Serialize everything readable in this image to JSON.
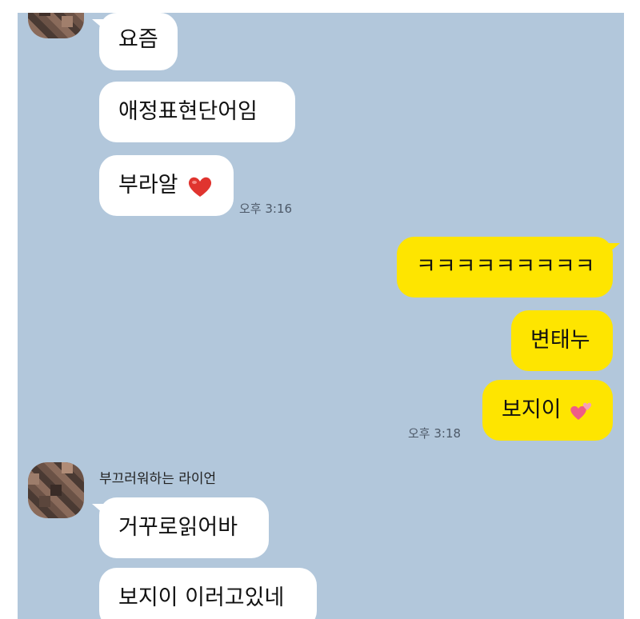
{
  "messages_top": [
    {
      "text": "요즘"
    },
    {
      "text": "애정표현단어임"
    },
    {
      "text": "부라알",
      "emoji": "heart"
    }
  ],
  "time_1": "오후 3:16",
  "messages_me": [
    {
      "text": "ㅋㅋㅋㅋㅋㅋㅋㅋㅋ"
    },
    {
      "text": "변태누"
    },
    {
      "text": "보지이",
      "emoji": "two-hearts"
    }
  ],
  "time_2": "오후 3:18",
  "sender_name": "부끄러워하는 라이언",
  "messages_bottom": [
    {
      "text": "거꾸로읽어바"
    },
    {
      "text": "보지이 이러고있네"
    }
  ],
  "colors": {
    "chat_bg": "#b2c7db",
    "my_bubble": "#fee500",
    "their_bubble": "#ffffff",
    "heart": "#e0342f"
  }
}
